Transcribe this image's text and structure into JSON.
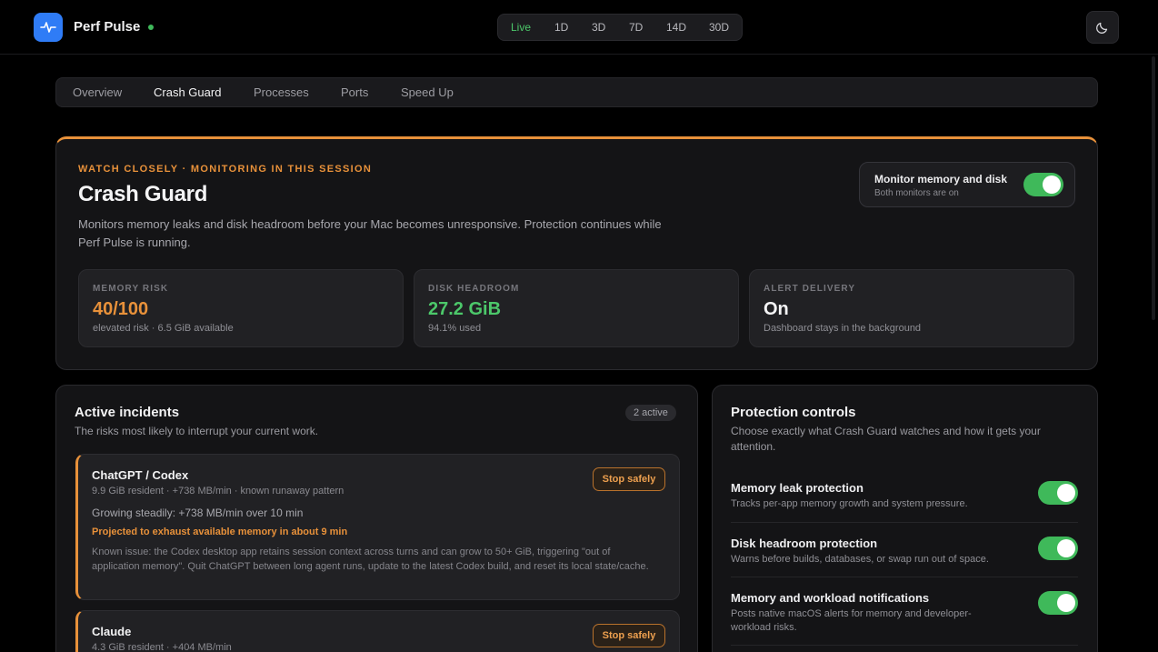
{
  "app": {
    "title": "Perf Pulse"
  },
  "ranges": [
    "Live",
    "1D",
    "3D",
    "7D",
    "14D",
    "30D"
  ],
  "tabs": [
    "Overview",
    "Crash Guard",
    "Processes",
    "Ports",
    "Speed Up"
  ],
  "hero": {
    "eyebrow": "WATCH CLOSELY · MONITORING IN THIS SESSION",
    "title": "Crash Guard",
    "description": "Monitors memory leaks and disk headroom before your Mac becomes unresponsive. Protection continues while Perf Pulse is running.",
    "monitor_label": "Monitor memory and disk",
    "monitor_sub": "Both monitors are on"
  },
  "stats": [
    {
      "label": "MEMORY RISK",
      "value": "40/100",
      "sub": "elevated risk · 6.5 GiB available",
      "color": "#e8913a"
    },
    {
      "label": "DISK HEADROOM",
      "value": "27.2 GiB",
      "sub": "94.1% used",
      "color": "#4cc86a"
    },
    {
      "label": "ALERT DELIVERY",
      "value": "On",
      "sub": "Dashboard stays in the background",
      "color": "#f4f4f5"
    }
  ],
  "incidents": {
    "title": "Active incidents",
    "subtitle": "The risks most likely to interrupt your current work.",
    "badge": "2 active",
    "items": [
      {
        "name": "ChatGPT / Codex",
        "meta": "9.9 GiB resident · +738 MB/min · known runaway pattern",
        "growth": "Growing steadily: +738 MB/min over 10 min",
        "projection": "Projected to exhaust available memory in about 9 min",
        "note": "Known issue: the Codex desktop app retains session context across turns and can grow to 50+ GiB, triggering \"out of application memory\". Quit ChatGPT between long agent runs, update to the latest Codex build, and reset its local state/cache.",
        "action": "Stop safely"
      },
      {
        "name": "Claude",
        "meta": "4.3 GiB resident · +404 MB/min",
        "action": "Stop safely"
      }
    ]
  },
  "controls": {
    "title": "Protection controls",
    "subtitle": "Choose exactly what Crash Guard watches and how it gets your attention.",
    "items": [
      {
        "title": "Memory leak protection",
        "desc": "Tracks per-app memory growth and system pressure.",
        "on": true
      },
      {
        "title": "Disk headroom protection",
        "desc": "Warns before builds, databases, or swap run out of space.",
        "on": true
      },
      {
        "title": "Memory and workload notifications",
        "desc": "Posts native macOS alerts for memory and developer-workload risks.",
        "on": true
      }
    ]
  },
  "colors": {
    "accent": "#2f7cf6",
    "warning": "#e8913a",
    "success": "#3fb95a"
  }
}
